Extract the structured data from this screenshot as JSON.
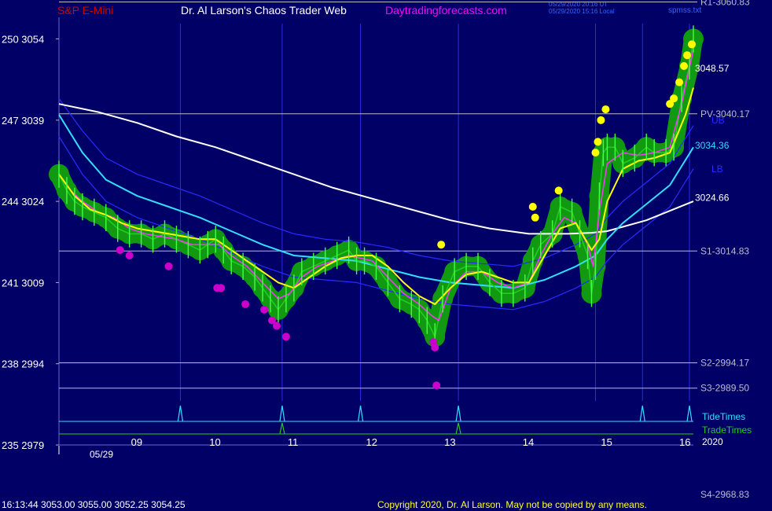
{
  "header": {
    "instrument": "S&P E-Mini",
    "site_title": "Dr. Al Larson's Chaos Trader Web",
    "site_url": "Daytradingforecasts.com",
    "timestamp_ut": "05/29/2020 20:16 UT",
    "timestamp_local": "05/29/2020 15:16 Local",
    "file_name": "spmss.txt"
  },
  "footer": {
    "quote": "16:13:44  3053.00 3055.00 3052.25 3054.25",
    "copyright": "Copyright 2020, Dr. Al Larson. May not be copied by any means."
  },
  "colors": {
    "background": "#000066",
    "price": "#22cc22",
    "halo": "#119911",
    "yellow_ma": "#ffff00",
    "magenta_ma": "#ff33ff",
    "cyan_ma": "#33ddff",
    "white_ma": "#ffffff",
    "band": "#2a2aff",
    "level_line": "#bbbbcc",
    "tide": "#33ddff",
    "trade": "#22cc22",
    "dot_yellow": "#ffff00",
    "dot_magenta": "#cc00cc",
    "title_red": "#cc0000",
    "title_white": "#ffffff",
    "title_magenta": "#ff00ff"
  },
  "chart_data": {
    "type": "line",
    "title": "S&P E-Mini",
    "date_label": "05/29",
    "year_label": "2020",
    "xlim": [
      8.0,
      16.1
    ],
    "ylim": [
      2979,
      3058
    ],
    "x_ticks": [
      {
        "x": 9,
        "label": "09"
      },
      {
        "x": 10,
        "label": "10"
      },
      {
        "x": 11,
        "label": "11"
      },
      {
        "x": 12,
        "label": "12"
      },
      {
        "x": 13,
        "label": "13"
      },
      {
        "x": 14,
        "label": "14"
      },
      {
        "x": 15,
        "label": "15"
      },
      {
        "x": 16,
        "label": "16"
      }
    ],
    "x_ticks_visible": [
      9,
      10,
      11,
      12,
      13,
      14,
      15,
      16
    ],
    "y_ticks": [
      {
        "value": 3054,
        "label": "250  3054"
      },
      {
        "value": 3039,
        "label": "247  3039"
      },
      {
        "value": 3024,
        "label": "244  3024"
      },
      {
        "value": 3009,
        "label": "241  3009"
      },
      {
        "value": 2994,
        "label": "238  2994"
      },
      {
        "value": 2979,
        "label": "235  2979"
      }
    ],
    "vertical_lines": [
      9.55,
      10.85,
      11.85,
      13.1,
      14.85,
      15.45,
      16.05
    ],
    "levels": [
      {
        "name": "R1",
        "label": "R1-3060.83",
        "value": 3060.83
      },
      {
        "name": "PV",
        "label": "PV-3040.17",
        "value": 3040.17
      },
      {
        "name": "S1",
        "label": "S1-3014.83",
        "value": 3014.83
      },
      {
        "name": "S2",
        "label": "S2-2994.17",
        "value": 2994.17
      },
      {
        "name": "S3",
        "label": "S3-2989.50",
        "value": 2989.5
      },
      {
        "name": "S4",
        "label": "S4-2968.83",
        "value": 2968.83
      }
    ],
    "right_labels": [
      {
        "text": "3048.57",
        "value": 3048.57,
        "color": "#ffffff"
      },
      {
        "text": "3034.36",
        "value": 3034.36,
        "color": "#33ddff"
      },
      {
        "text": "3024.66",
        "value": 3024.66,
        "color": "#ffffff"
      },
      {
        "text": "UB",
        "value": 3039.0,
        "color": "#2a2aff"
      },
      {
        "text": "LB",
        "value": 3030.0,
        "color": "#2a2aff"
      }
    ],
    "series": [
      {
        "name": "price",
        "x": [
          8.0,
          8.1,
          8.2,
          8.3,
          8.45,
          8.6,
          8.75,
          8.9,
          9.05,
          9.2,
          9.35,
          9.5,
          9.65,
          9.8,
          9.9,
          10.0,
          10.1,
          10.2,
          10.35,
          10.5,
          10.6,
          10.7,
          10.8,
          10.9,
          11.0,
          11.1,
          11.25,
          11.4,
          11.55,
          11.7,
          11.8,
          11.9,
          12.05,
          12.2,
          12.35,
          12.5,
          12.6,
          12.7,
          12.8,
          12.9,
          13.05,
          13.2,
          13.35,
          13.5,
          13.65,
          13.8,
          13.95,
          14.05,
          14.15,
          14.3,
          14.4,
          14.55,
          14.65,
          14.75,
          14.8,
          14.85,
          14.9,
          14.95,
          15.0,
          15.1,
          15.2,
          15.35,
          15.5,
          15.6,
          15.75,
          15.85,
          15.95,
          16.05,
          16.1
        ],
        "values": [
          3029,
          3026,
          3024,
          3023,
          3022,
          3021,
          3019,
          3018,
          3018,
          3017,
          3018,
          3017,
          3016,
          3015,
          3016,
          3017,
          3015,
          3013,
          3012,
          3010,
          3008,
          3006,
          3004,
          3006,
          3008,
          3011,
          3012,
          3013,
          3014,
          3015,
          3013,
          3013,
          3012,
          3009,
          3006,
          3005,
          3004,
          3002,
          2999,
          3006,
          3011,
          3012,
          3012,
          3009,
          3007,
          3007,
          3008,
          3013,
          3016,
          3018,
          3023,
          3022,
          3018,
          3014,
          3007,
          3012,
          3025,
          3033,
          3034,
          3034,
          3031,
          3032,
          3034,
          3033,
          3033,
          3034,
          3043,
          3049,
          3054
        ]
      },
      {
        "name": "magenta-ma",
        "x": [
          8.0,
          8.15,
          8.3,
          8.5,
          8.7,
          8.9,
          9.1,
          9.3,
          9.5,
          9.7,
          9.9,
          10.05,
          10.2,
          10.4,
          10.6,
          10.8,
          10.95,
          11.1,
          11.3,
          11.5,
          11.7,
          11.85,
          12.0,
          12.2,
          12.4,
          12.6,
          12.75,
          12.85,
          13.0,
          13.2,
          13.4,
          13.6,
          13.8,
          14.0,
          14.15,
          14.3,
          14.45,
          14.6,
          14.75,
          14.82,
          14.9,
          15.0,
          15.2,
          15.4,
          15.6,
          15.8,
          15.95,
          16.1
        ],
        "values": [
          3029,
          3026,
          3024,
          3022,
          3021,
          3019,
          3018,
          3017.5,
          3017,
          3016,
          3016,
          3016,
          3014,
          3012,
          3009,
          3006,
          3007,
          3010,
          3012,
          3013,
          3014,
          3013.5,
          3013,
          3010,
          3007,
          3005,
          3003,
          3002,
          3008,
          3011,
          3011,
          3009,
          3008,
          3009,
          3014,
          3018,
          3021,
          3020,
          3016,
          3012,
          3022,
          3031,
          3033,
          3032.5,
          3033,
          3034,
          3042,
          3052
        ]
      },
      {
        "name": "yellow-ma",
        "x": [
          8.0,
          8.2,
          8.4,
          8.6,
          8.8,
          9.0,
          9.2,
          9.4,
          9.6,
          9.8,
          10.0,
          10.2,
          10.4,
          10.6,
          10.8,
          11.0,
          11.2,
          11.4,
          11.6,
          11.8,
          12.0,
          12.2,
          12.4,
          12.6,
          12.8,
          13.0,
          13.2,
          13.4,
          13.6,
          13.8,
          14.0,
          14.2,
          14.4,
          14.6,
          14.8,
          14.9,
          15.0,
          15.2,
          15.4,
          15.6,
          15.8,
          16.0,
          16.1
        ],
        "values": [
          3029,
          3025,
          3022.5,
          3021.5,
          3020,
          3019,
          3018.5,
          3018,
          3017.5,
          3017,
          3017,
          3015,
          3013,
          3011,
          3009,
          3008,
          3010,
          3012,
          3013.5,
          3014,
          3014,
          3012,
          3009,
          3006.5,
          3005,
          3008,
          3010.5,
          3011,
          3010,
          3009,
          3009,
          3014,
          3019,
          3020,
          3015,
          3017,
          3024,
          3030,
          3031.5,
          3032,
          3033,
          3040,
          3045
        ]
      },
      {
        "name": "cyan-ma",
        "x": [
          8.0,
          8.3,
          8.6,
          9.0,
          9.4,
          9.8,
          10.2,
          10.6,
          11.0,
          11.4,
          11.8,
          12.2,
          12.6,
          13.0,
          13.4,
          13.8,
          14.2,
          14.6,
          14.85,
          15.0,
          15.2,
          15.5,
          15.8,
          16.1
        ],
        "values": [
          3040,
          3033,
          3028,
          3025,
          3023,
          3021,
          3018.5,
          3016,
          3014,
          3013.5,
          3013,
          3011.5,
          3010,
          3009,
          3008.5,
          3008,
          3009.5,
          3012,
          3014,
          3017,
          3020,
          3023.5,
          3027,
          3034
        ]
      },
      {
        "name": "white-ma",
        "x": [
          8.0,
          8.5,
          9.0,
          9.5,
          10.0,
          10.5,
          11.0,
          11.5,
          12.0,
          12.5,
          13.0,
          13.5,
          14.0,
          14.5,
          14.8,
          15.0,
          15.5,
          16.1
        ],
        "values": [
          3042,
          3040.5,
          3038.5,
          3036,
          3034,
          3031.5,
          3029,
          3026.5,
          3024.5,
          3022.5,
          3020.5,
          3019,
          3018,
          3018,
          3018.2,
          3018.5,
          3020.5,
          3024
        ]
      },
      {
        "name": "upper-band",
        "x": [
          8.0,
          8.3,
          8.6,
          9.0,
          9.4,
          9.8,
          10.2,
          10.6,
          11.0,
          11.4,
          11.8,
          12.2,
          12.6,
          13.0,
          13.4,
          13.8,
          14.2,
          14.6,
          14.85,
          15.0,
          15.2,
          15.5,
          15.8,
          16.1
        ],
        "values": [
          3043,
          3037,
          3032,
          3029,
          3027,
          3025,
          3022.5,
          3020,
          3018,
          3017,
          3016.5,
          3015.5,
          3014,
          3013,
          3012.5,
          3012,
          3013.5,
          3016,
          3018,
          3021,
          3024,
          3027.5,
          3031,
          3038
        ]
      },
      {
        "name": "lower-band",
        "x": [
          8.0,
          8.3,
          8.6,
          9.0,
          9.4,
          9.8,
          10.2,
          10.6,
          11.0,
          11.4,
          11.8,
          12.2,
          12.6,
          13.0,
          13.4,
          13.8,
          14.2,
          14.6,
          14.85,
          15.0,
          15.2,
          15.5,
          15.8,
          16.1
        ],
        "values": [
          3036,
          3029,
          3024,
          3021,
          3019,
          3017,
          3014.5,
          3012,
          3010,
          3009.5,
          3009,
          3007.5,
          3006,
          3005,
          3004.5,
          3004,
          3005.5,
          3008,
          3010,
          3013,
          3016,
          3019.5,
          3023,
          3030
        ]
      }
    ],
    "yellow_dots": [
      {
        "x": 12.88,
        "y": 3016
      },
      {
        "x": 14.05,
        "y": 3023
      },
      {
        "x": 14.08,
        "y": 3021
      },
      {
        "x": 14.38,
        "y": 3026
      },
      {
        "x": 14.85,
        "y": 3033
      },
      {
        "x": 14.88,
        "y": 3035
      },
      {
        "x": 14.92,
        "y": 3039
      },
      {
        "x": 14.98,
        "y": 3041
      },
      {
        "x": 15.8,
        "y": 3042
      },
      {
        "x": 15.85,
        "y": 3043
      },
      {
        "x": 15.92,
        "y": 3046
      },
      {
        "x": 15.98,
        "y": 3049
      },
      {
        "x": 16.02,
        "y": 3051
      },
      {
        "x": 16.08,
        "y": 3053
      }
    ],
    "magenta_dots": [
      {
        "x": 8.78,
        "y": 3015
      },
      {
        "x": 8.9,
        "y": 3014
      },
      {
        "x": 9.4,
        "y": 3012
      },
      {
        "x": 10.02,
        "y": 3008
      },
      {
        "x": 10.07,
        "y": 3008
      },
      {
        "x": 10.38,
        "y": 3005
      },
      {
        "x": 10.62,
        "y": 3004
      },
      {
        "x": 10.72,
        "y": 3002
      },
      {
        "x": 10.78,
        "y": 3001
      },
      {
        "x": 10.9,
        "y": 2999
      },
      {
        "x": 12.78,
        "y": 2998
      },
      {
        "x": 12.8,
        "y": 2997
      },
      {
        "x": 12.82,
        "y": 2990
      }
    ],
    "tide_times": [
      9.55,
      10.85,
      11.85,
      13.1,
      15.45,
      16.05
    ],
    "trade_times": [
      10.85,
      13.1
    ],
    "tide_label": "TideTimes",
    "trade_label": "TradeTimes"
  }
}
